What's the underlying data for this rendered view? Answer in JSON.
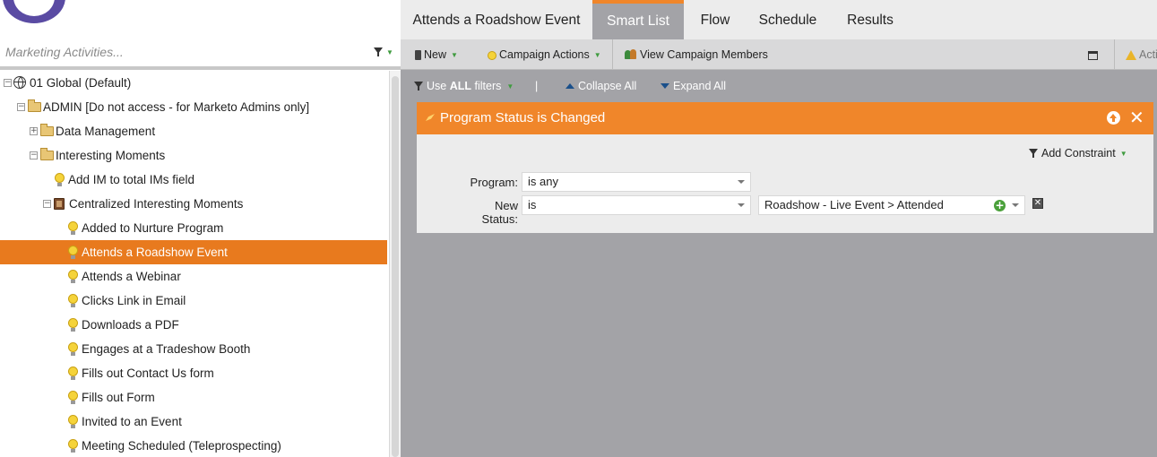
{
  "sidebar": {
    "search_placeholder": "Marketing Activities...",
    "tree": [
      {
        "label": "01 Global (Default)",
        "icon": "globe-icon",
        "expander": "−"
      },
      {
        "label": "ADMIN [Do not access - for Marketo Admins only]",
        "icon": "folder-icon",
        "expander": "−"
      },
      {
        "label": "Data Management",
        "icon": "folder-icon",
        "expander": "+"
      },
      {
        "label": "Interesting Moments",
        "icon": "folder-icon",
        "expander": "−"
      },
      {
        "label": "Add IM to total IMs field",
        "icon": "lightbulb-icon"
      },
      {
        "label": "Centralized Interesting Moments",
        "icon": "program-icon",
        "expander": "−"
      },
      {
        "label": "Added to Nurture Program",
        "icon": "lightbulb-icon"
      },
      {
        "label": "Attends a Roadshow Event",
        "icon": "lightbulb-icon",
        "selected": true
      },
      {
        "label": "Attends a Webinar",
        "icon": "lightbulb-icon"
      },
      {
        "label": "Clicks Link in Email",
        "icon": "lightbulb-icon"
      },
      {
        "label": "Downloads a PDF",
        "icon": "lightbulb-icon"
      },
      {
        "label": "Engages at a Tradeshow Booth",
        "icon": "lightbulb-icon"
      },
      {
        "label": "Fills out Contact Us form",
        "icon": "lightbulb-icon"
      },
      {
        "label": "Fills out Form",
        "icon": "lightbulb-icon"
      },
      {
        "label": "Invited to an Event",
        "icon": "lightbulb-icon"
      },
      {
        "label": "Meeting Scheduled (Teleprospecting)",
        "icon": "lightbulb-icon"
      }
    ]
  },
  "tabs": [
    {
      "label": "Attends a Roadshow Event"
    },
    {
      "label": "Smart List",
      "active": true
    },
    {
      "label": "Flow"
    },
    {
      "label": "Schedule"
    },
    {
      "label": "Results"
    }
  ],
  "toolbar": {
    "new_label": "New",
    "campaign_actions_label": "Campaign Actions",
    "view_members_label": "View Campaign Members",
    "cut_label": "Acti"
  },
  "filter_bar": {
    "use_prefix": "Use ",
    "use_bold": "ALL",
    "use_suffix": " filters",
    "separator": "|",
    "collapse_label": "Collapse All",
    "expand_label": "Expand All"
  },
  "filter": {
    "title": "Program Status is Changed",
    "add_constraint_label": "Add Constraint",
    "rows": [
      {
        "label": "Program:",
        "operator": "is any"
      },
      {
        "label": "New Status:",
        "operator": "is",
        "value": "Roadshow - Live Event > Attended"
      }
    ]
  },
  "colors": {
    "accent_orange": "#f0862a",
    "selected_row": "#e87a1e",
    "canvas_gray": "#a3a3a7",
    "logo_purple": "#5a4ba3"
  }
}
